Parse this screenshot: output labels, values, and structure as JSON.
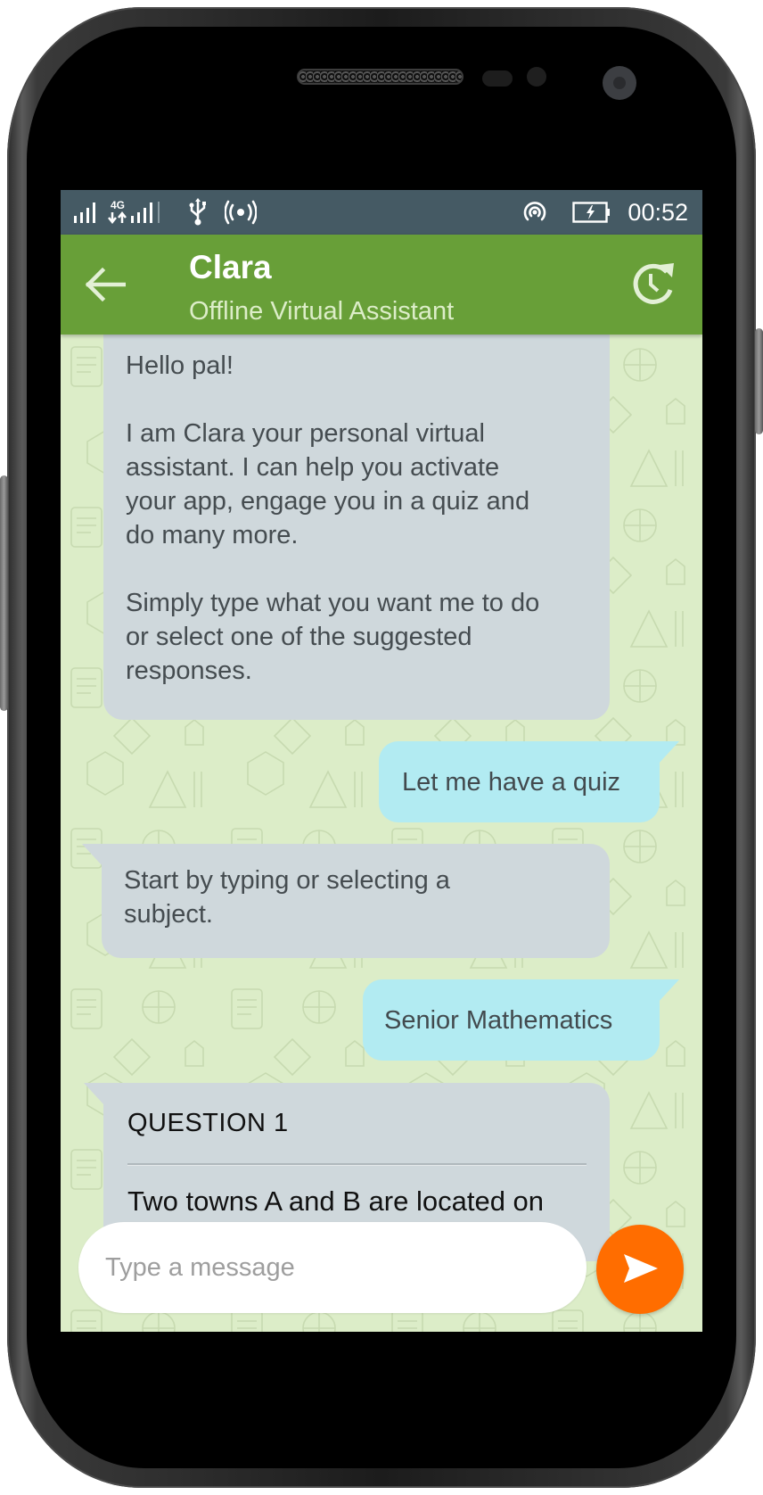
{
  "statusbar": {
    "network_label": "4G",
    "time": "00:52",
    "icons": [
      "signal-strength-icon",
      "4g-data-icon",
      "signal-strength-icon",
      "usb-icon",
      "hotspot-icon",
      "nfc-broadcast-icon",
      "battery-charging-icon"
    ]
  },
  "appbar": {
    "back_icon": "arrow-left-icon",
    "title": "Clara",
    "subtitle": "Offline Virtual Assistant",
    "action_icon": "restore-history-icon"
  },
  "messages": [
    {
      "sender": "bot",
      "lines": [
        "Hello pal!",
        "",
        "I am Clara your personal virtual",
        "assistant. I can help you activate",
        "your app, engage you in a quiz and",
        "do many more.",
        "",
        "Simply type what you want me to do",
        "or select one of the suggested",
        "responses."
      ]
    },
    {
      "sender": "user",
      "text": "Let me have a quiz"
    },
    {
      "sender": "bot",
      "lines": [
        "Start by typing or selecting a",
        "subject."
      ]
    },
    {
      "sender": "user",
      "text": "Senior Mathematics"
    },
    {
      "sender": "bot",
      "type": "question",
      "title": "QUESTION 1",
      "text": "Two towns A and B are located on"
    }
  ],
  "composer": {
    "placeholder": "Type a message",
    "value": "",
    "send_icon": "send-icon"
  },
  "colors": {
    "statusbar": "#455a64",
    "appbar": "#689f38",
    "chat_background": "#dcedc8",
    "bot_bubble": "#cfd8dc",
    "user_bubble": "#b2ebf2",
    "send_button": "#ff6d00"
  }
}
